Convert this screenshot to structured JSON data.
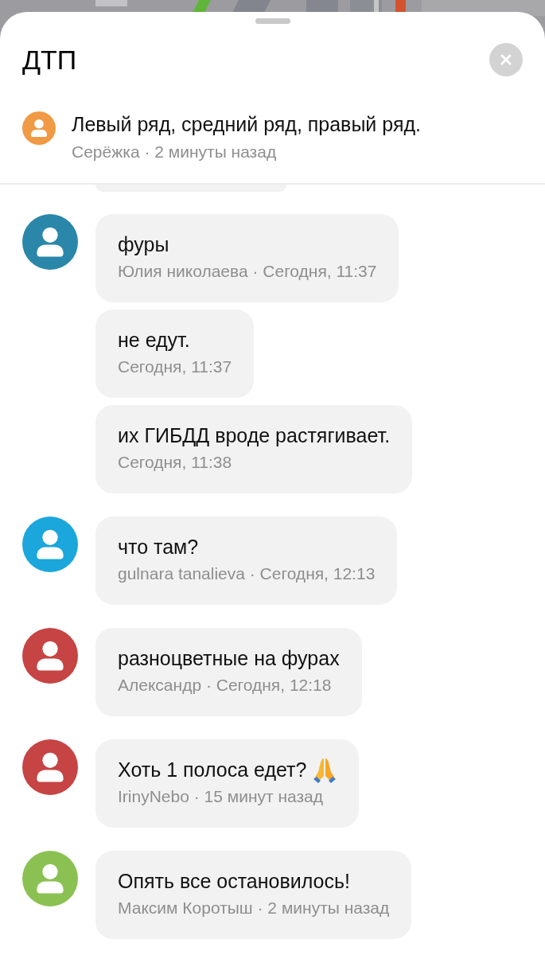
{
  "sheet": {
    "title": "ДТП"
  },
  "pinned": {
    "color": "#f09a45",
    "text": "Левый ряд, средний ряд, правый ряд.",
    "meta": "Серёжка · 2 минуты назад"
  },
  "threads": [
    {
      "color": "#2a87a9",
      "messages": [
        {
          "kind": "text",
          "text": "фуры",
          "meta": "Юлия николаева · Сегодня, 11:37"
        },
        {
          "kind": "text",
          "text": "не едут.",
          "meta": "Сегодня, 11:37"
        },
        {
          "kind": "text",
          "text": "их ГИБДД вроде растягивает.",
          "meta": "Сегодня, 11:38"
        }
      ]
    },
    {
      "color": "#1ba6dc",
      "messages": [
        {
          "kind": "text",
          "text": "что там?",
          "meta": "gulnara tanalieva · Сегодня, 12:13"
        }
      ]
    },
    {
      "color": "#c64444",
      "messages": [
        {
          "kind": "text",
          "text": "разноцветные на фурах",
          "meta": "Александр · Сегодня, 12:18"
        }
      ]
    },
    {
      "color": "#c64444",
      "messages": [
        {
          "kind": "emoji",
          "text": "Хоть 1 полоса едет?",
          "meta": "IrinyNebo · 15 минут назад"
        }
      ]
    },
    {
      "color": "#8bc152",
      "messages": [
        {
          "kind": "text",
          "text": "Опять все остановилось!",
          "meta": "Максим Коротыш · 2 минуты назад"
        }
      ]
    }
  ]
}
